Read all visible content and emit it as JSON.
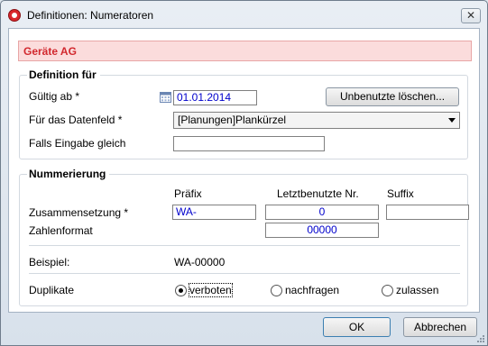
{
  "window": {
    "title": "Definitionen: Numeratoren",
    "close_glyph": "✕"
  },
  "company": "Geräte AG",
  "definition": {
    "group_title": "Definition für",
    "valid_from_label": "Gültig ab *",
    "valid_from_value": "01.01.2014",
    "delete_unused_button": "Unbenutzte löschen...",
    "datafield_label": "Für das Datenfeld *",
    "datafield_value": "[Planungen]Plankürzel",
    "condition_label": "Falls Eingabe gleich",
    "condition_value": ""
  },
  "numbering": {
    "group_title": "Nummerierung",
    "col_prefix": "Präfix",
    "col_last_used": "Letztbenutzte Nr.",
    "col_suffix": "Suffix",
    "composition_label": "Zusammensetzung *",
    "prefix_value": "WA-",
    "last_used_value": "0",
    "suffix_value": "",
    "number_format_label": "Zahlenformat",
    "number_format_value": "00000",
    "example_label": "Beispiel:",
    "example_value": "WA-00000",
    "duplicates_label": "Duplikate",
    "duplicate_options": [
      {
        "label": "verboten",
        "checked": true
      },
      {
        "label": "nachfragen",
        "checked": false
      },
      {
        "label": "zulassen",
        "checked": false
      }
    ]
  },
  "footer": {
    "ok_label": "OK",
    "cancel_label": "Abbrechen"
  },
  "colors": {
    "company_text": "#d2282e",
    "company_bg": "#fbdcdc",
    "field_text": "#0000cc"
  },
  "icons": [
    "app-icon",
    "close-icon",
    "calendar-icon",
    "chevron-down-icon",
    "resize-grip-icon"
  ]
}
